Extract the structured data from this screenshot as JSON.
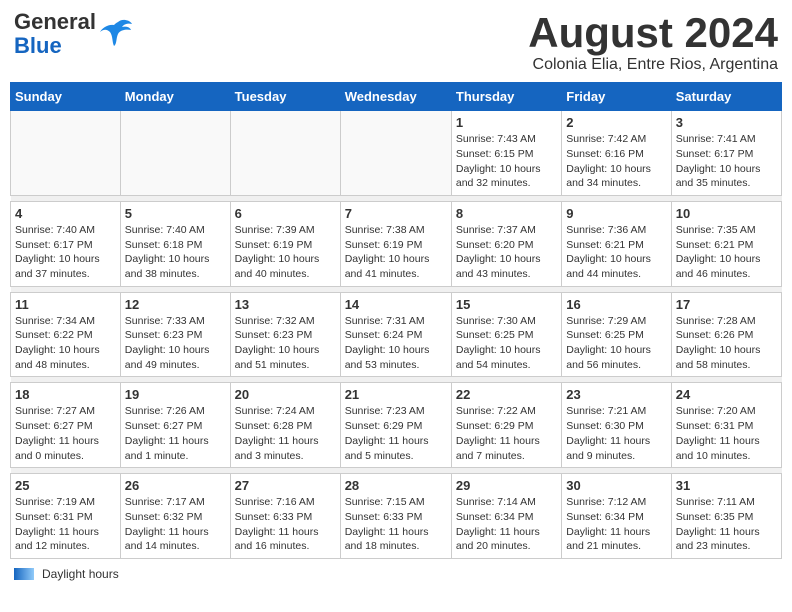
{
  "header": {
    "logo_general": "General",
    "logo_blue": "Blue",
    "month_title": "August 2024",
    "location": "Colonia Elia, Entre Rios, Argentina"
  },
  "weekdays": [
    "Sunday",
    "Monday",
    "Tuesday",
    "Wednesday",
    "Thursday",
    "Friday",
    "Saturday"
  ],
  "weeks": [
    [
      {
        "day": "",
        "info": ""
      },
      {
        "day": "",
        "info": ""
      },
      {
        "day": "",
        "info": ""
      },
      {
        "day": "",
        "info": ""
      },
      {
        "day": "1",
        "info": "Sunrise: 7:43 AM\nSunset: 6:15 PM\nDaylight: 10 hours\nand 32 minutes."
      },
      {
        "day": "2",
        "info": "Sunrise: 7:42 AM\nSunset: 6:16 PM\nDaylight: 10 hours\nand 34 minutes."
      },
      {
        "day": "3",
        "info": "Sunrise: 7:41 AM\nSunset: 6:17 PM\nDaylight: 10 hours\nand 35 minutes."
      }
    ],
    [
      {
        "day": "4",
        "info": "Sunrise: 7:40 AM\nSunset: 6:17 PM\nDaylight: 10 hours\nand 37 minutes."
      },
      {
        "day": "5",
        "info": "Sunrise: 7:40 AM\nSunset: 6:18 PM\nDaylight: 10 hours\nand 38 minutes."
      },
      {
        "day": "6",
        "info": "Sunrise: 7:39 AM\nSunset: 6:19 PM\nDaylight: 10 hours\nand 40 minutes."
      },
      {
        "day": "7",
        "info": "Sunrise: 7:38 AM\nSunset: 6:19 PM\nDaylight: 10 hours\nand 41 minutes."
      },
      {
        "day": "8",
        "info": "Sunrise: 7:37 AM\nSunset: 6:20 PM\nDaylight: 10 hours\nand 43 minutes."
      },
      {
        "day": "9",
        "info": "Sunrise: 7:36 AM\nSunset: 6:21 PM\nDaylight: 10 hours\nand 44 minutes."
      },
      {
        "day": "10",
        "info": "Sunrise: 7:35 AM\nSunset: 6:21 PM\nDaylight: 10 hours\nand 46 minutes."
      }
    ],
    [
      {
        "day": "11",
        "info": "Sunrise: 7:34 AM\nSunset: 6:22 PM\nDaylight: 10 hours\nand 48 minutes."
      },
      {
        "day": "12",
        "info": "Sunrise: 7:33 AM\nSunset: 6:23 PM\nDaylight: 10 hours\nand 49 minutes."
      },
      {
        "day": "13",
        "info": "Sunrise: 7:32 AM\nSunset: 6:23 PM\nDaylight: 10 hours\nand 51 minutes."
      },
      {
        "day": "14",
        "info": "Sunrise: 7:31 AM\nSunset: 6:24 PM\nDaylight: 10 hours\nand 53 minutes."
      },
      {
        "day": "15",
        "info": "Sunrise: 7:30 AM\nSunset: 6:25 PM\nDaylight: 10 hours\nand 54 minutes."
      },
      {
        "day": "16",
        "info": "Sunrise: 7:29 AM\nSunset: 6:25 PM\nDaylight: 10 hours\nand 56 minutes."
      },
      {
        "day": "17",
        "info": "Sunrise: 7:28 AM\nSunset: 6:26 PM\nDaylight: 10 hours\nand 58 minutes."
      }
    ],
    [
      {
        "day": "18",
        "info": "Sunrise: 7:27 AM\nSunset: 6:27 PM\nDaylight: 11 hours\nand 0 minutes."
      },
      {
        "day": "19",
        "info": "Sunrise: 7:26 AM\nSunset: 6:27 PM\nDaylight: 11 hours\nand 1 minute."
      },
      {
        "day": "20",
        "info": "Sunrise: 7:24 AM\nSunset: 6:28 PM\nDaylight: 11 hours\nand 3 minutes."
      },
      {
        "day": "21",
        "info": "Sunrise: 7:23 AM\nSunset: 6:29 PM\nDaylight: 11 hours\nand 5 minutes."
      },
      {
        "day": "22",
        "info": "Sunrise: 7:22 AM\nSunset: 6:29 PM\nDaylight: 11 hours\nand 7 minutes."
      },
      {
        "day": "23",
        "info": "Sunrise: 7:21 AM\nSunset: 6:30 PM\nDaylight: 11 hours\nand 9 minutes."
      },
      {
        "day": "24",
        "info": "Sunrise: 7:20 AM\nSunset: 6:31 PM\nDaylight: 11 hours\nand 10 minutes."
      }
    ],
    [
      {
        "day": "25",
        "info": "Sunrise: 7:19 AM\nSunset: 6:31 PM\nDaylight: 11 hours\nand 12 minutes."
      },
      {
        "day": "26",
        "info": "Sunrise: 7:17 AM\nSunset: 6:32 PM\nDaylight: 11 hours\nand 14 minutes."
      },
      {
        "day": "27",
        "info": "Sunrise: 7:16 AM\nSunset: 6:33 PM\nDaylight: 11 hours\nand 16 minutes."
      },
      {
        "day": "28",
        "info": "Sunrise: 7:15 AM\nSunset: 6:33 PM\nDaylight: 11 hours\nand 18 minutes."
      },
      {
        "day": "29",
        "info": "Sunrise: 7:14 AM\nSunset: 6:34 PM\nDaylight: 11 hours\nand 20 minutes."
      },
      {
        "day": "30",
        "info": "Sunrise: 7:12 AM\nSunset: 6:34 PM\nDaylight: 11 hours\nand 21 minutes."
      },
      {
        "day": "31",
        "info": "Sunrise: 7:11 AM\nSunset: 6:35 PM\nDaylight: 11 hours\nand 23 minutes."
      }
    ]
  ],
  "footer": {
    "daylight_label": "Daylight hours"
  }
}
